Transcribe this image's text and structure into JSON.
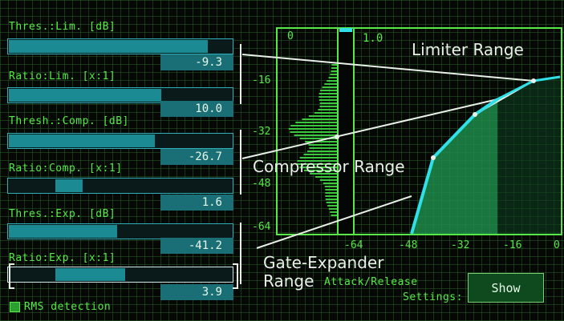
{
  "controls": [
    {
      "label": "Thres.:Lim. [dB]",
      "value": "-9.3",
      "level": 0.88
    },
    {
      "label": "Ratio:Lim. [x:1]",
      "value": "10.0",
      "level": 0.68
    },
    {
      "label": "Thresh.:Comp. [dB]",
      "value": "-26.7",
      "level": 0.65
    },
    {
      "label": "Ratio:Comp. [x:1]",
      "value": "1.6",
      "level_start": 0.21,
      "level_end": 0.33
    },
    {
      "label": "Thres.:Exp. [dB]",
      "value": "-41.2",
      "level": 0.48
    },
    {
      "label": "Ratio:Exp. [x:1]",
      "value": "3.9",
      "level_start": 0.21,
      "level_end": 0.52
    }
  ],
  "graph": {
    "y_axis": [
      "0",
      "-16",
      "-32",
      "-48",
      "-64"
    ],
    "x_axis": [
      "-64",
      "-48",
      "-32",
      "-16",
      "0"
    ],
    "meter_value": "1.0"
  },
  "ranges": {
    "limiter": "Limiter Range",
    "compressor": "Compressor Range",
    "gate_line1": "Gate-Expander",
    "gate_line2": "Range"
  },
  "attack_release": {
    "line1": "Attack/Release",
    "line2": "Settings:",
    "button": "Show"
  },
  "rms": {
    "label": "RMS detection",
    "checked": true
  },
  "colors": {
    "accent_green": "#58e848",
    "cyan": "#2fe0e8",
    "panel_teal": "#1c8a92"
  }
}
